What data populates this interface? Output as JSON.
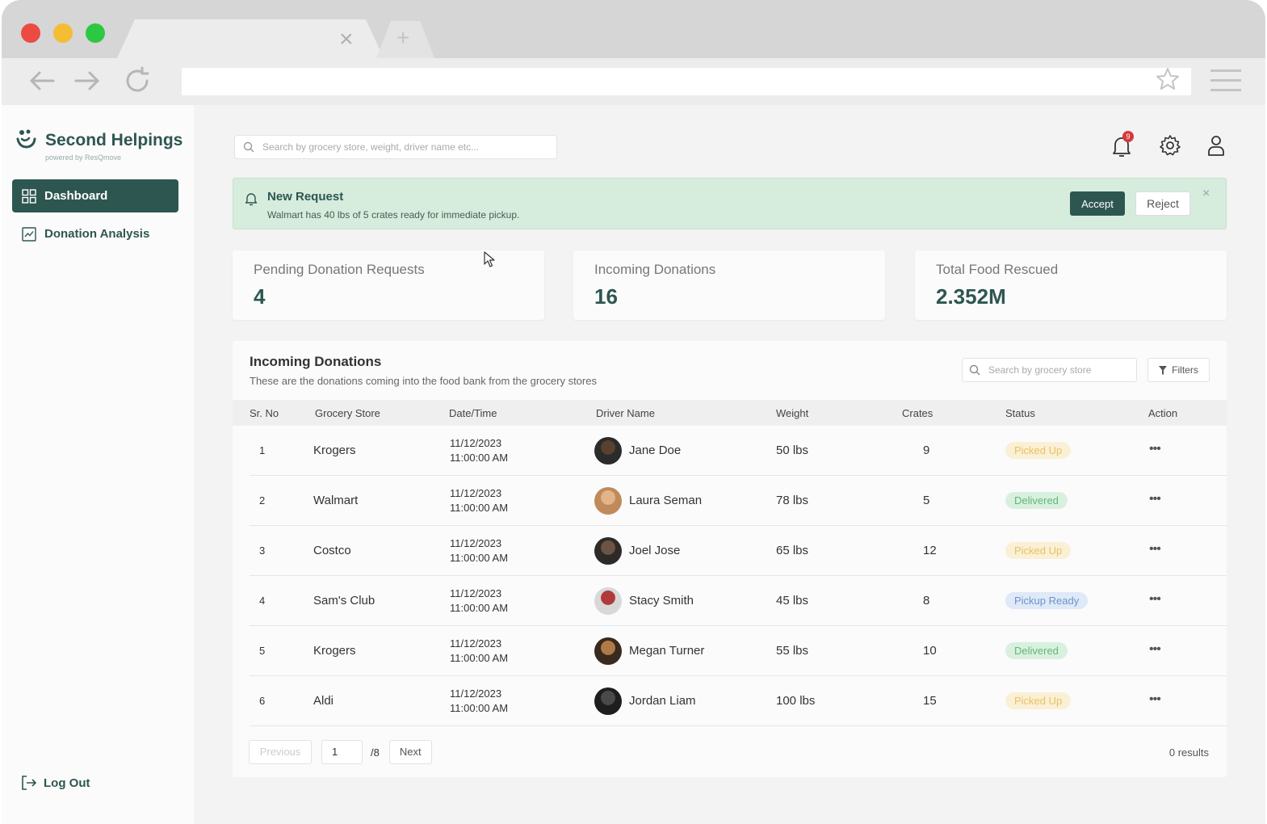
{
  "browser": {
    "tab_close": "×",
    "tab_new": "+"
  },
  "brand": {
    "name": "Second Helpings",
    "sub": "powered by ResQmove"
  },
  "sidebar": {
    "items": [
      {
        "label": "Dashboard",
        "icon": "grid-icon",
        "active": true
      },
      {
        "label": "Donation Analysis",
        "icon": "chart-icon",
        "active": false
      }
    ],
    "logout": "Log Out"
  },
  "header": {
    "search_placeholder": "Search by grocery store, weight, driver name etc...",
    "notification_count": "9"
  },
  "banner": {
    "title": "New Request",
    "message": "Walmart has 40 lbs of 5 crates ready for immediate pickup.",
    "accept": "Accept",
    "reject": "Reject",
    "close": "×"
  },
  "stats": [
    {
      "label": "Pending Donation Requests",
      "value": "4"
    },
    {
      "label": "Incoming Donations",
      "value": "16"
    },
    {
      "label": "Total Food Rescued",
      "value": "2.352M"
    }
  ],
  "table": {
    "title": "Incoming Donations",
    "subtitle": "These are the donations coming into the food bank from the grocery stores",
    "search_placeholder": "Search by grocery store",
    "filters": "Filters",
    "columns": [
      "Sr. No",
      "Grocery Store",
      "Date/Time",
      "Driver Name",
      "Weight",
      "Crates",
      "Status",
      "Action"
    ],
    "rows": [
      {
        "sr": "1",
        "store": "Krogers",
        "date": "11/12/2023",
        "time": "11:00:00 AM",
        "driver": "Jane Doe",
        "weight": "50 lbs",
        "crates": "9",
        "status": "Picked Up",
        "status_kind": "picked"
      },
      {
        "sr": "2",
        "store": "Walmart",
        "date": "11/12/2023",
        "time": "11:00:00 AM",
        "driver": "Laura Seman",
        "weight": "78 lbs",
        "crates": "5",
        "status": "Delivered",
        "status_kind": "delivered"
      },
      {
        "sr": "3",
        "store": "Costco",
        "date": "11/12/2023",
        "time": "11:00:00 AM",
        "driver": "Joel Jose",
        "weight": "65 lbs",
        "crates": "12",
        "status": "Picked Up",
        "status_kind": "picked"
      },
      {
        "sr": "4",
        "store": "Sam's Club",
        "date": "11/12/2023",
        "time": "11:00:00 AM",
        "driver": "Stacy Smith",
        "weight": "45 lbs",
        "crates": "8",
        "status": "Pickup Ready",
        "status_kind": "ready"
      },
      {
        "sr": "5",
        "store": "Krogers",
        "date": "11/12/2023",
        "time": "11:00:00 AM",
        "driver": "Megan Turner",
        "weight": "55 lbs",
        "crates": "10",
        "status": "Delivered",
        "status_kind": "delivered"
      },
      {
        "sr": "6",
        "store": "Aldi",
        "date": "11/12/2023",
        "time": "11:00:00 AM",
        "driver": "Jordan Liam",
        "weight": "100 lbs",
        "crates": "15",
        "status": "Picked Up",
        "status_kind": "picked"
      }
    ],
    "action_icon": "•••"
  },
  "pagination": {
    "previous": "Previous",
    "page": "1",
    "total": "/8",
    "next": "Next",
    "results": "0 results"
  },
  "colors": {
    "brand": "#2e5651",
    "banner_bg": "#d6ecdd",
    "picked": "#e9c163",
    "delivered": "#5fb878",
    "ready": "#6d95c8"
  }
}
